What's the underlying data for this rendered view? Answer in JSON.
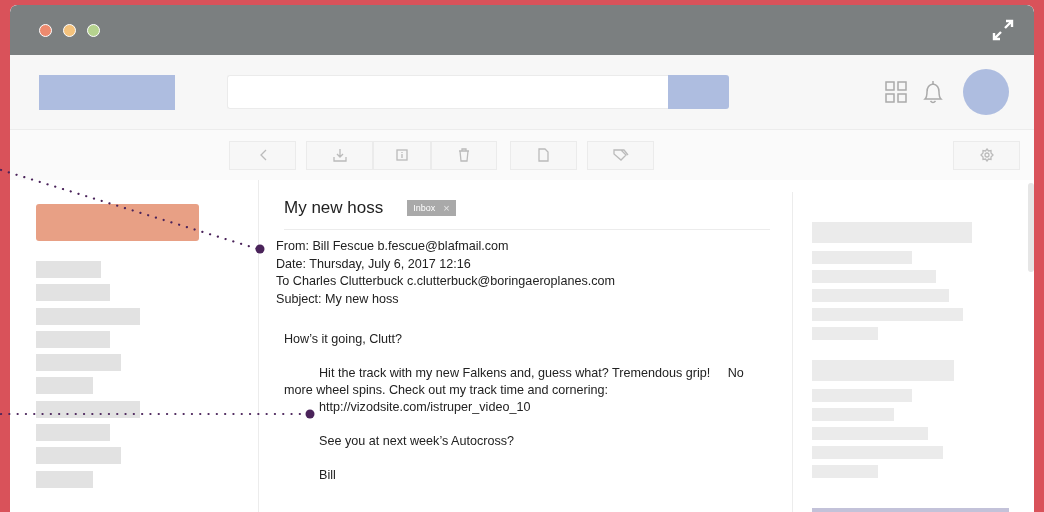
{
  "email": {
    "subject": "My new hoss",
    "tag": {
      "label": "Inbox",
      "close": "×"
    },
    "headers": [
      "From: Bill Fescue b.fescue@blafmail.com",
      "Date: Thursday, July 6, 2017 12:16",
      "To Charles Clutterbuck c.clutterbuck@boringaeroplanes.com",
      "Subject: My new hoss"
    ],
    "body": [
      {
        "kind": "greeting",
        "text": "How’s it going, Clutt?"
      },
      {
        "kind": "paragraph",
        "text": "Hit the track with my new Falkens and, guess what? Tremendous grip!     No more wheel spins. Check out my track time and cornering:"
      },
      {
        "kind": "link",
        "text": "http://vizodsite.com/istruper_video_10"
      },
      {
        "kind": "line",
        "text": "See you at next week’s Autocross?"
      },
      {
        "kind": "signature",
        "text": "Bill"
      }
    ]
  }
}
